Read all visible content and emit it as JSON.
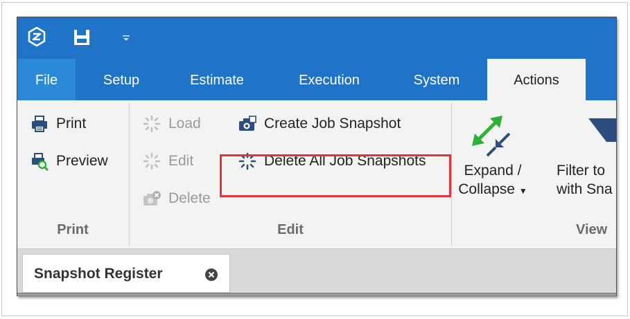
{
  "app": {
    "icons": {
      "logo": "app-logo-icon",
      "save": "save-icon",
      "quick_access": "chevron-down-icon"
    }
  },
  "tabs": [
    {
      "label": "File"
    },
    {
      "label": "Setup"
    },
    {
      "label": "Estimate"
    },
    {
      "label": "Execution"
    },
    {
      "label": "System"
    },
    {
      "label": "Actions"
    }
  ],
  "ribbon": {
    "print_group": {
      "label": "Print",
      "print_label": "Print",
      "preview_label": "Preview"
    },
    "edit_group": {
      "label": "Edit",
      "load_label": "Load",
      "edit_label": "Edit",
      "delete_label": "Delete",
      "create_snapshot_label": "Create Job Snapshot",
      "delete_all_snapshots_label": "Delete All Job Snapshots"
    },
    "view_group": {
      "label": "View",
      "expand_line1": "Expand /",
      "expand_line2": "Collapse",
      "filter_line1": "Filter to",
      "filter_line2": "with Sna"
    }
  },
  "document_tabs": [
    {
      "label": "Snapshot Register"
    }
  ],
  "colors": {
    "title_bar": "#1f74c9",
    "file_tab": "#2a8ad8",
    "active_tab": "#f3f3f3",
    "highlight_box": "#e0353b",
    "accent_green": "#2fae3a"
  }
}
